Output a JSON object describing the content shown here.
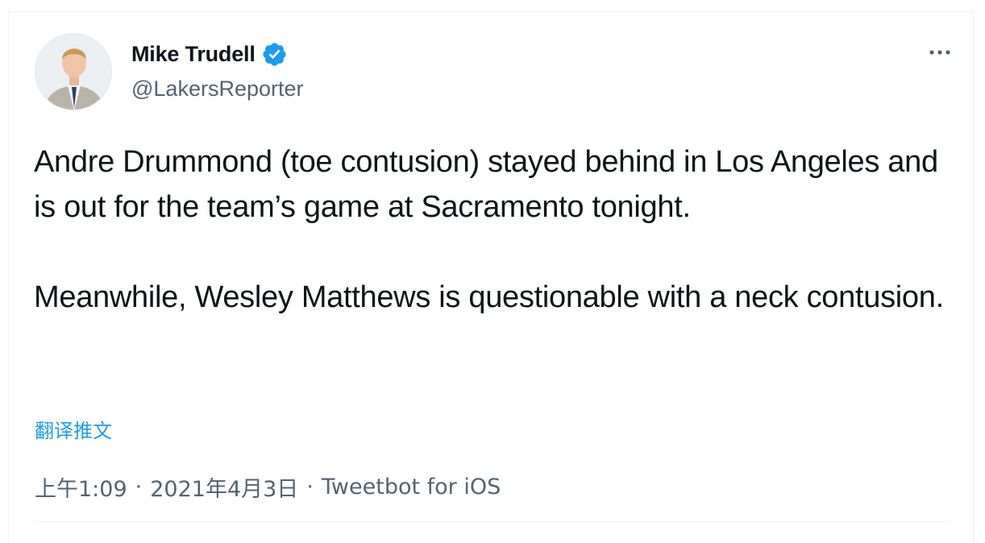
{
  "author": {
    "name": "Mike Trudell",
    "handle": "@LakersReporter",
    "verified": true,
    "avatar_icon": "avatar-photo"
  },
  "tweet": {
    "paragraphs": [
      "Andre Drummond (toe contusion) stayed behind in Los Angeles and is out for the team’s game at Sacramento tonight.",
      "Meanwhile, Wesley Matthews is questionable with a neck contusion."
    ],
    "translate_label": "翻译推文"
  },
  "meta": {
    "time": "上午1:09",
    "separator": "·",
    "date": "2021年4月3日",
    "source": "Tweetbot for iOS"
  },
  "colors": {
    "accent": "#1d9bf0",
    "text": "#0f1419",
    "secondary": "#536471"
  },
  "icons": {
    "verified": "verified-badge-icon",
    "more": "more-dots-icon"
  }
}
